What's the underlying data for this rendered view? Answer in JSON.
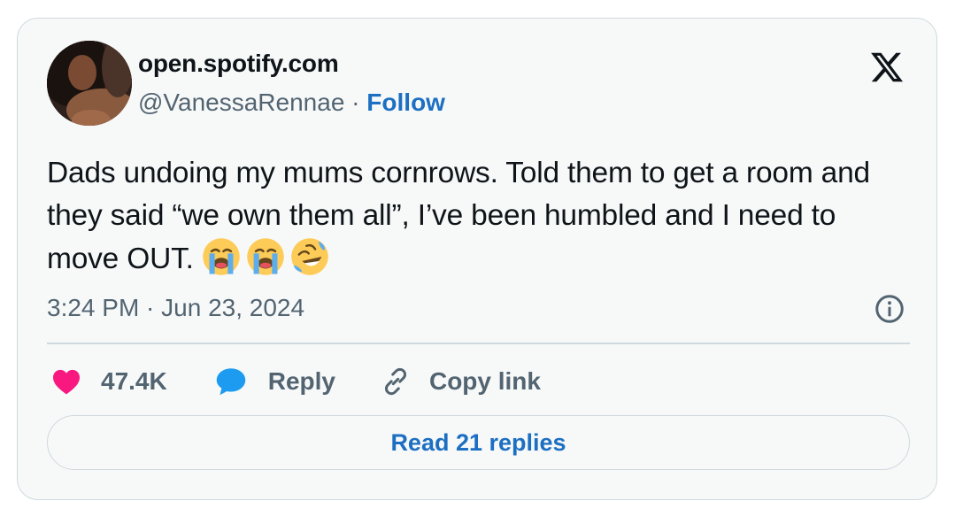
{
  "author": {
    "name": "open.spotify.com",
    "handle": "@VanessaRennae",
    "separator": " · ",
    "follow_label": "Follow"
  },
  "tweet": {
    "text": "Dads undoing my mums cornrows. Told them to get a room and they said “we own them all”, I’ve been humbled and I need to move OUT.",
    "emojis": [
      "loudly-crying-face",
      "loudly-crying-face",
      "rolling-on-the-floor-laughing"
    ],
    "timestamp": "3:24 PM · Jun 23, 2024"
  },
  "actions": {
    "likes": "47.4K",
    "reply_label": "Reply",
    "copy_link_label": "Copy link"
  },
  "read_replies_label": "Read 21 replies",
  "icons": {
    "brand": "x-logo-icon",
    "like": "heart-icon",
    "reply": "speech-bubble-icon",
    "copy": "link-icon",
    "info": "info-icon"
  },
  "colors": {
    "like": "#f91880",
    "reply": "#1d9bf0",
    "link": "#1d6fc2",
    "secondary_text": "#536471",
    "border": "#cfd9de",
    "card_background": "#f7f9f9"
  }
}
